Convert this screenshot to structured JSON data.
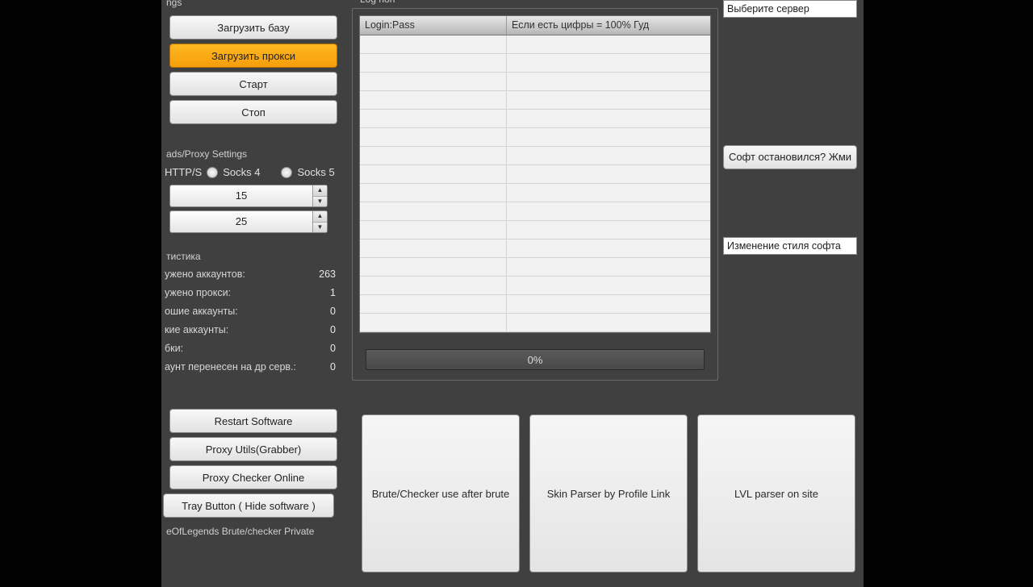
{
  "left": {
    "settings_label": "ngs",
    "load_base": "Загрузить базу",
    "load_proxy": "Загрузить прокси",
    "start": "Старт",
    "stop": "Стоп",
    "proxy_label": "ads/Proxy Settings",
    "proxy_type_1": "HTTP/S",
    "proxy_type_2": "Socks 4",
    "proxy_type_3": "Socks 5",
    "spinner1": "15",
    "spinner2": "25",
    "stats_label": "тистика",
    "stat1_label": "ужено аккаунтов:",
    "stat1_val": "263",
    "stat2_label": "ужено прокси:",
    "stat2_val": "1",
    "stat3_label": "ошие аккаунты:",
    "stat3_val": "0",
    "stat4_label": "кие аккаунты:",
    "stat4_val": "0",
    "stat5_label": "бки:",
    "stat5_val": "0",
    "stat6_label": "аунт перенесен на др серв.:",
    "stat6_val": "0",
    "restart": "Restart Software",
    "proxy_utils": "Proxy Utils(Grabber)",
    "proxy_checker": "Proxy Checker Online",
    "tray": "Tray Button ( Hide software )",
    "title_bottom": "eOfLegends Brute/checker Private"
  },
  "center": {
    "box_label": "Log  non",
    "col1": "Login:Pass",
    "col2": "Если есть цифры  = 100% Гуд",
    "progress": "0%"
  },
  "cards": {
    "c1": "Brute/Checker use after brute",
    "c2": "Skin Parser by Profile Link",
    "c3": "LVL parser on site"
  },
  "right": {
    "server_select": "Выберите сервер",
    "stopped_btn": "Софт остановился? Жми",
    "style_select": "Изменение стиля софта"
  }
}
